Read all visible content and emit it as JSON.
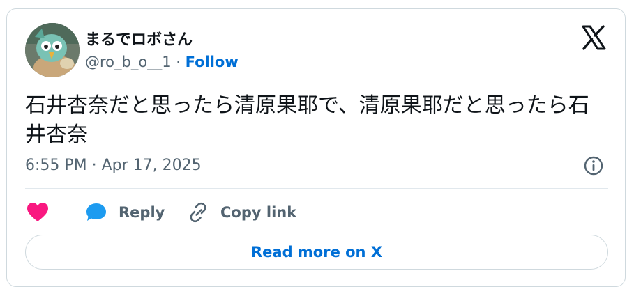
{
  "author": {
    "display_name": "まるでロボさん",
    "handle": "@ro_b_o__1",
    "separator": " · ",
    "follow_label": "Follow"
  },
  "tweet": {
    "text": "石井杏奈だと思ったら清原果耶で、清原果耶だと思ったら石井杏奈",
    "timestamp": "6:55 PM · Apr 17, 2025"
  },
  "actions": {
    "like_icon": "heart-icon",
    "reply_icon": "speech-bubble-icon",
    "reply_label": "Reply",
    "copy_icon": "link-icon",
    "copy_label": "Copy link"
  },
  "footer": {
    "read_more_label": "Read more on X"
  },
  "colors": {
    "like": "#f91880",
    "reply": "#1d9bf0",
    "link_blue": "#006fd6",
    "secondary_text": "#536471",
    "border": "#cfd9de"
  }
}
